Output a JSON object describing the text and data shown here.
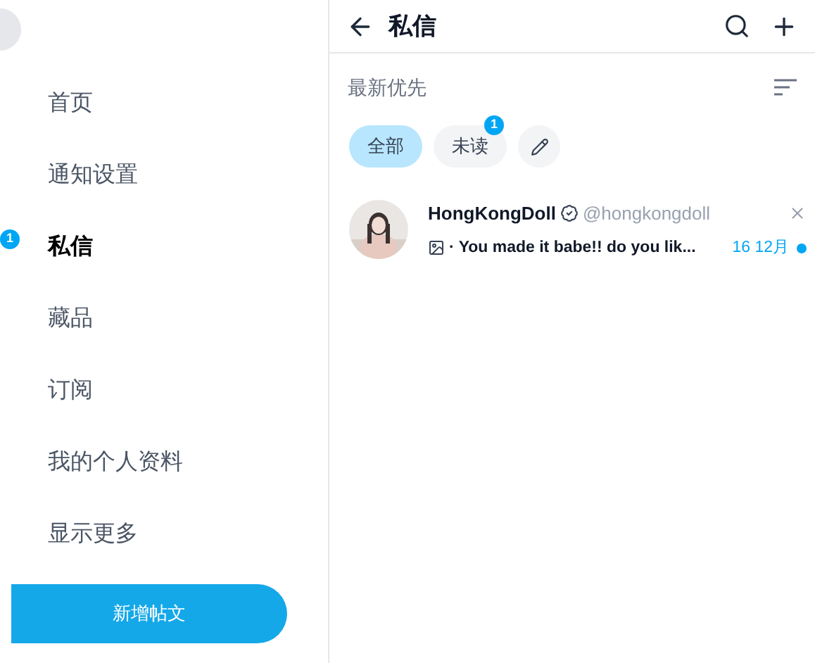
{
  "sidebar": {
    "items": [
      {
        "label": "首页",
        "selected": false
      },
      {
        "label": "通知设置",
        "selected": false
      },
      {
        "label": "私信",
        "selected": true,
        "badge": "1"
      },
      {
        "label": "藏品",
        "selected": false
      },
      {
        "label": "订阅",
        "selected": false
      },
      {
        "label": "我的个人资料",
        "selected": false
      },
      {
        "label": "显示更多",
        "selected": false
      }
    ],
    "post_button": "新增帖文"
  },
  "header": {
    "title": "私信"
  },
  "sort": {
    "label": "最新优先"
  },
  "filters": [
    {
      "label": "全部",
      "selected": true
    },
    {
      "label": "未读",
      "selected": false,
      "badge": "1"
    }
  ],
  "conversations": [
    {
      "name": "HongKongDoll",
      "verified": true,
      "handle": "@hongkongdoll",
      "preview": "· You made it babe!! do you lik...",
      "date": "16 12月",
      "unread": true
    }
  ]
}
